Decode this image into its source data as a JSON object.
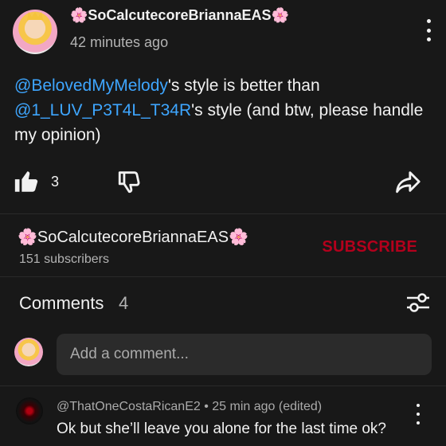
{
  "post": {
    "author": "🌸SoCalcutecoreBriannaEAS🌸",
    "timestamp": "42 minutes ago",
    "mention1": "@BelovedMyMelody",
    "text1": "'s style is better than",
    "mention2": "@1_LUV_P3T4L_T34R",
    "text2": "'s style (and btw, please handle my opinion)",
    "like_count": "3"
  },
  "channel": {
    "name": "🌸SoCalcutecoreBriannaEAS🌸",
    "subscribers": "151 subscribers",
    "subscribe_label": "SUBSCRIBE"
  },
  "comments": {
    "title": "Comments",
    "count": "4",
    "add_placeholder": "Add a comment...",
    "items": [
      {
        "meta": "@ThatOneCostaRicanE2 • 25 min ago (edited)",
        "text": "Ok but she’ll leave you alone for the last time ok?"
      }
    ]
  },
  "colors": {
    "background": "#181818",
    "mention": "#3ea6ff",
    "subscribe": "#b3001c"
  },
  "icons": [
    "kebab-icon",
    "thumbs-up-icon",
    "thumbs-down-icon",
    "share-icon",
    "filter-icon"
  ]
}
